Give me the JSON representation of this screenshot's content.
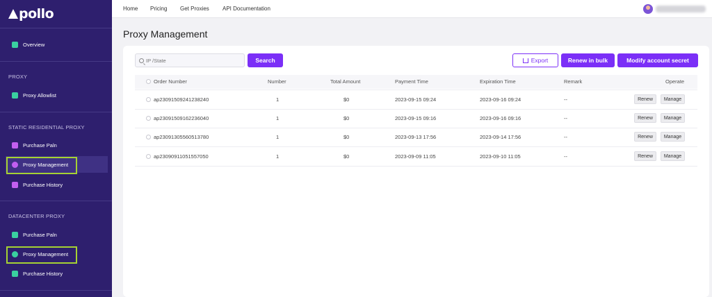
{
  "brand": {
    "logo": "pollo"
  },
  "sidebar": {
    "overview": "Overview",
    "sections": [
      "PROXY",
      "STATIC RESIDENTIAL PROXY",
      "DATACENTER PROXY"
    ],
    "proxy_allowlist": "Proxy Allowlist",
    "static": {
      "purchase_plan": "Purchase Paln",
      "proxy_management": "Proxy Management",
      "purchase_history": "Purchase History"
    },
    "datacenter": {
      "purchase_plan": "Purchase Paln",
      "proxy_management": "Proxy Management",
      "purchase_history": "Purchase History"
    },
    "icon_colors": {
      "overview": "#3ad0a0",
      "allowlist": "#3ad0a0",
      "purchase_static": "#c25ff0",
      "management_static": "#c25ff0",
      "history_static": "#c25ff0",
      "purchase_dc": "#3ad0a0",
      "management_dc": "#3ad0a0",
      "history_dc": "#3ad0a0"
    }
  },
  "topnav": [
    "Home",
    "Pricing",
    "Get Proxies",
    "API Documentation"
  ],
  "page_title": "Proxy Management",
  "search": {
    "placeholder": "IP /State",
    "button": "Search"
  },
  "actions": {
    "export": "Export",
    "renew_bulk": "Renew in bulk",
    "modify_secret": "Modify account secret"
  },
  "table": {
    "headers": [
      "Order Number",
      "Number",
      "Total Amount",
      "Payment Time",
      "Expiration Time",
      "Remark",
      "Operate"
    ],
    "rows": [
      {
        "order": "ap23091509241238240",
        "number": "1",
        "amount": "$0",
        "payment": "2023-09-15 09:24",
        "expiration": "2023-09-16 09:24",
        "remark": "--"
      },
      {
        "order": "ap23091509162236040",
        "number": "1",
        "amount": "$0",
        "payment": "2023-09-15 09:16",
        "expiration": "2023-09-16 09:16",
        "remark": "--"
      },
      {
        "order": "ap23091305560513780",
        "number": "1",
        "amount": "$0",
        "payment": "2023-09-13 17:56",
        "expiration": "2023-09-14 17:56",
        "remark": "--"
      },
      {
        "order": "ap23090911051557050",
        "number": "1",
        "amount": "$0",
        "payment": "2023-09-09 11:05",
        "expiration": "2023-09-10 11:05",
        "remark": "--"
      }
    ],
    "renew_label": "Renew",
    "manage_label": "Manage"
  },
  "colors": {
    "sidebar": "#2e1f6e",
    "accent": "#7b2ff7",
    "highlight": "#a6d233"
  }
}
